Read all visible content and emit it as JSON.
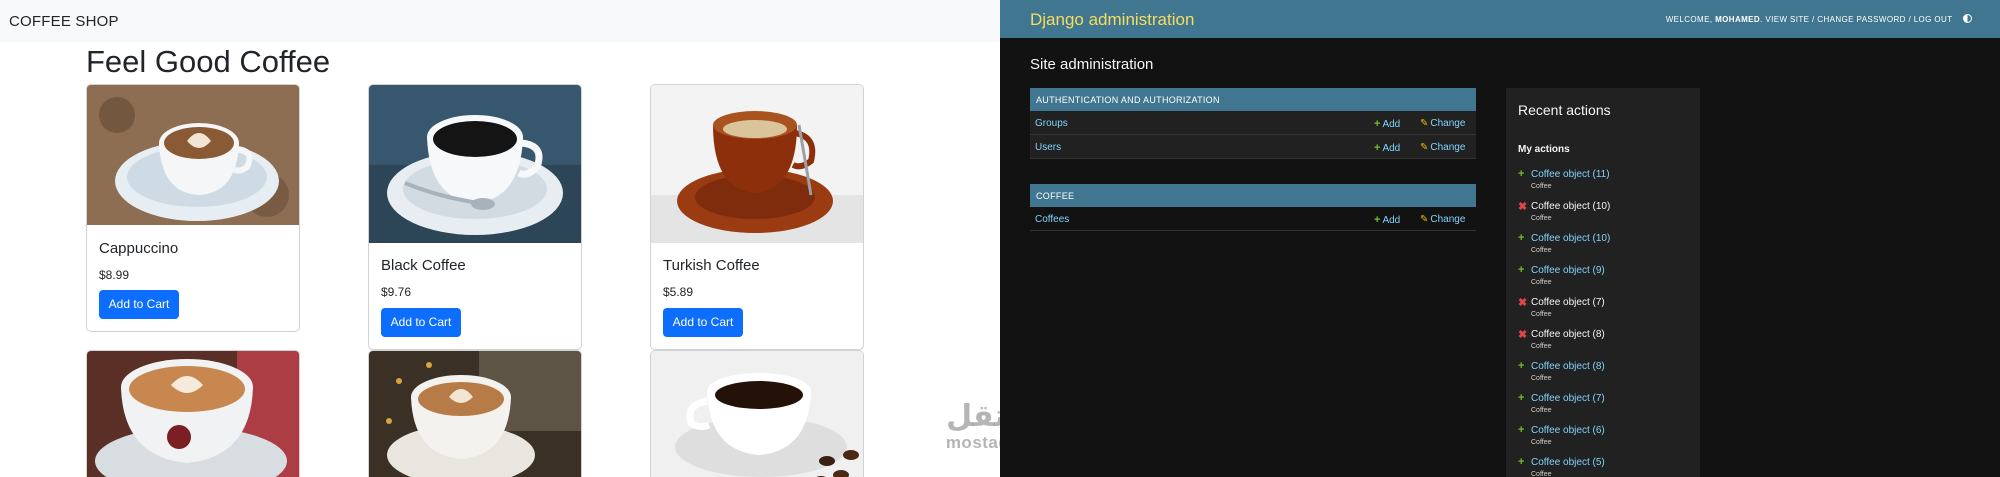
{
  "shop": {
    "brand": "COFFEE SHOP",
    "title": "Feel Good Coffee",
    "products": [
      {
        "name": "Cappuccino",
        "price": "$8.99",
        "button": "Add to Cart"
      },
      {
        "name": "Black Coffee",
        "price": "$9.76",
        "button": "Add to Cart"
      },
      {
        "name": "Turkish Coffee",
        "price": "$5.89",
        "button": "Add to Cart"
      }
    ],
    "primary_color": "#0d6efd"
  },
  "watermark": {
    "arabic": "مستقل",
    "latin": "mostaql.com"
  },
  "admin": {
    "branding": "Django administration",
    "user_tools": {
      "welcome": "WELCOME,",
      "user": "MOHAMED",
      "view_site": "VIEW SITE",
      "change_password": "CHANGE PASSWORD",
      "log_out": "LOG OUT",
      "separator": "/"
    },
    "site_title": "Site administration",
    "modules": [
      {
        "caption": "AUTHENTICATION AND AUTHORIZATION",
        "rows": [
          {
            "name": "Groups",
            "add": "Add",
            "change": "Change"
          },
          {
            "name": "Users",
            "add": "Add",
            "change": "Change"
          }
        ]
      },
      {
        "caption": "COFFEE",
        "rows": [
          {
            "name": "Coffees",
            "add": "Add",
            "change": "Change"
          }
        ]
      }
    ],
    "recent": {
      "title": "Recent actions",
      "my_actions": "My actions",
      "items": [
        {
          "icon": "plus-icon",
          "label": "Coffee object (11)",
          "type": "Coffee"
        },
        {
          "icon": "delete-icon",
          "label": "Coffee object (10)",
          "type": "Coffee"
        },
        {
          "icon": "plus-icon",
          "label": "Coffee object (10)",
          "type": "Coffee"
        },
        {
          "icon": "plus-icon",
          "label": "Coffee object (9)",
          "type": "Coffee"
        },
        {
          "icon": "delete-icon",
          "label": "Coffee object (7)",
          "type": "Coffee"
        },
        {
          "icon": "delete-icon",
          "label": "Coffee object (8)",
          "type": "Coffee"
        },
        {
          "icon": "plus-icon",
          "label": "Coffee object (8)",
          "type": "Coffee"
        },
        {
          "icon": "plus-icon",
          "label": "Coffee object (7)",
          "type": "Coffee"
        },
        {
          "icon": "plus-icon",
          "label": "Coffee object (6)",
          "type": "Coffee"
        },
        {
          "icon": "plus-icon",
          "label": "Coffee object (5)",
          "type": "Coffee"
        }
      ]
    },
    "colors": {
      "header": "#417690",
      "branding": "#f5dd5d",
      "link": "#81d4fa",
      "add": "#70bf2b",
      "delete": "#dd4646",
      "change": "#efb80b"
    }
  }
}
